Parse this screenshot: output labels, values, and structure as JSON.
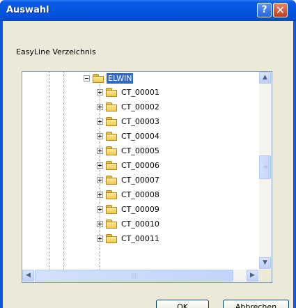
{
  "window": {
    "title": "Auswahl",
    "help_label": "?",
    "close_label": "✕"
  },
  "dialog": {
    "caption": "EasyLine Verzeichnis"
  },
  "tree": {
    "root": {
      "label": "ELWIN",
      "expanded": true,
      "selected": true
    },
    "children": [
      "CT_00001",
      "CT_00002",
      "CT_00003",
      "CT_00004",
      "CT_00005",
      "CT_00006",
      "CT_00007",
      "CT_00008",
      "CT_00009",
      "CT_00010",
      "CT_00011"
    ]
  },
  "buttons": {
    "ok": "OK",
    "cancel": "Abbrechen"
  },
  "colors": {
    "titlebar": "#0454de",
    "selection": "#316ac5",
    "dialog_bg": "#ece9d8"
  }
}
